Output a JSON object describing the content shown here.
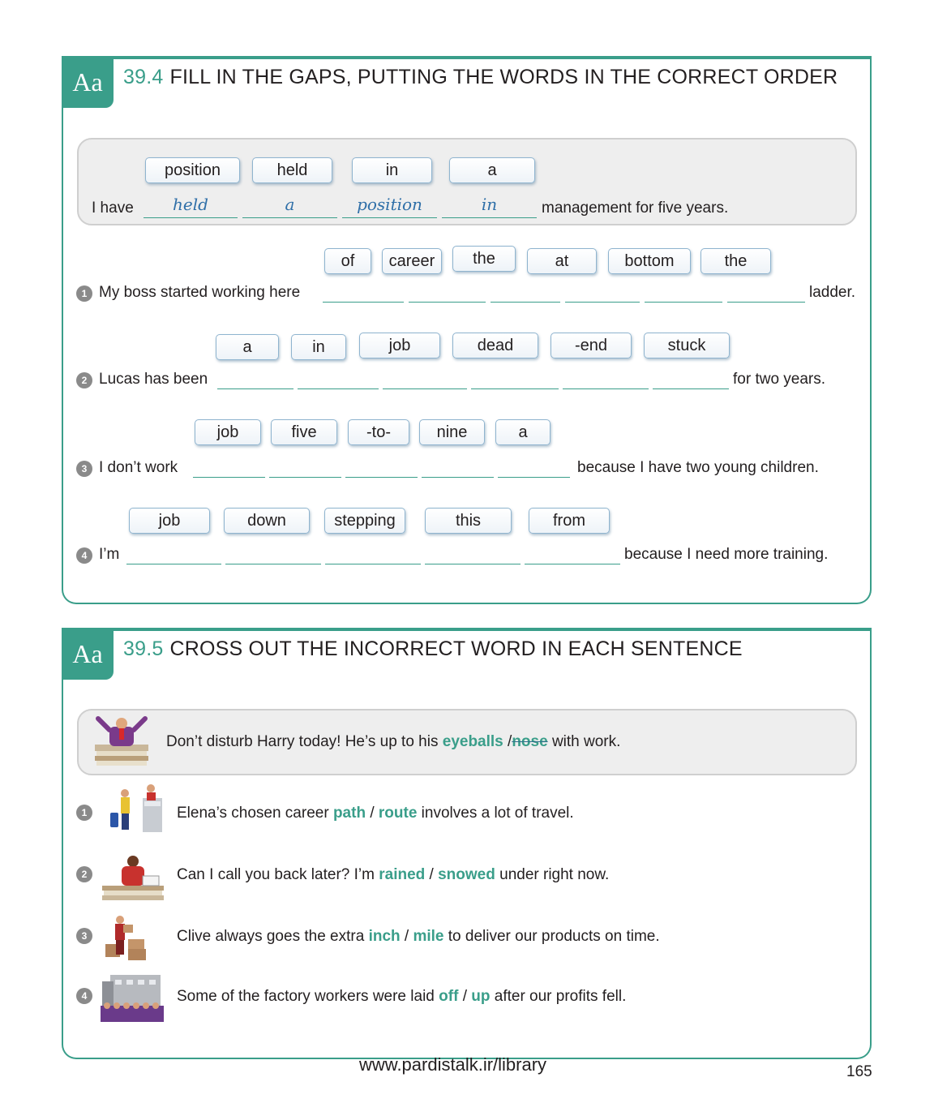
{
  "ex1": {
    "tag": "Aa",
    "number": "39.4",
    "title": "FILL IN THE GAPS, PUTTING THE WORDS IN THE CORRECT ORDER",
    "example": {
      "chips": [
        "position",
        "held",
        "in",
        "a"
      ],
      "prefix": "I have",
      "answers": [
        "held",
        "a",
        "position",
        "in"
      ],
      "suffix": "management for five years."
    },
    "items": [
      {
        "num": "1",
        "chips": [
          "of",
          "career",
          "the",
          "at",
          "bottom",
          "the"
        ],
        "prefix": "My boss started working here",
        "suffix": "ladder."
      },
      {
        "num": "2",
        "chips": [
          "a",
          "in",
          "job",
          "dead",
          "-end",
          "stuck"
        ],
        "prefix": "Lucas has been",
        "suffix": "for two years."
      },
      {
        "num": "3",
        "chips": [
          "job",
          "five",
          "-to-",
          "nine",
          "a"
        ],
        "prefix": "I don’t work",
        "suffix": "because I have two young children."
      },
      {
        "num": "4",
        "chips": [
          "job",
          "down",
          "stepping",
          "this",
          "from"
        ],
        "prefix": "I’m",
        "suffix": "because I need more training."
      }
    ]
  },
  "ex2": {
    "tag": "Aa",
    "number": "39.5",
    "title": "CROSS OUT THE INCORRECT WORD IN EACH SENTENCE",
    "example": {
      "before": "Don’t disturb Harry today! He’s up to his",
      "opt1": "eyeballs",
      "sep": "/",
      "opt2": "nose",
      "after": "with work."
    },
    "items": [
      {
        "num": "1",
        "before": "Elena’s chosen career",
        "opt1": "path",
        "sep": "/",
        "opt2": "route",
        "after": "involves a lot of travel."
      },
      {
        "num": "2",
        "before": "Can I call you back later? I’m",
        "opt1": "rained",
        "sep": "/",
        "opt2": "snowed",
        "after": "under right now."
      },
      {
        "num": "3",
        "before": "Clive always goes the extra",
        "opt1": "inch",
        "sep": "/",
        "opt2": "mile",
        "after": "to deliver our products on time."
      },
      {
        "num": "4",
        "before": "Some of the factory workers were laid",
        "opt1": "off",
        "sep": "/",
        "opt2": "up",
        "after": "after our profits fell."
      }
    ]
  },
  "footer": {
    "url": "www.pardistalk.ir/library",
    "page": "165"
  },
  "colors": {
    "accent": "#3a9e8a",
    "answer": "#2f6fa8"
  }
}
